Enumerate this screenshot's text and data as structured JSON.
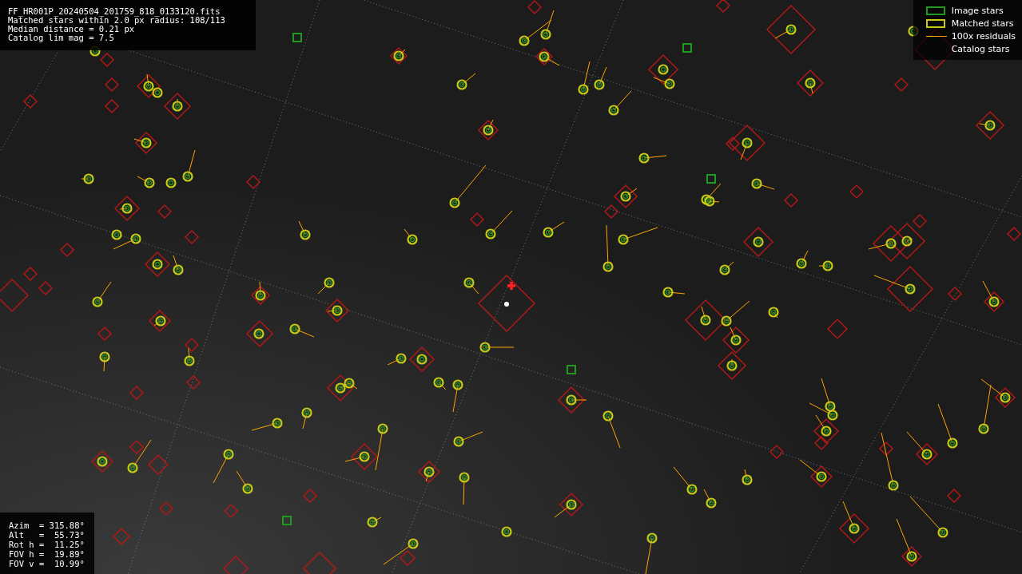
{
  "info": {
    "lines": [
      "FF_HR001P_20240504_201759_818_0133120.fits",
      "Matched stars within 2.0 px radius: 108/113",
      "Median distance = 0.21 px",
      "Catalog lim mag = 7.5"
    ]
  },
  "legend": [
    {
      "kind": "image",
      "label": "Image stars"
    },
    {
      "kind": "matched",
      "label": "Matched stars"
    },
    {
      "kind": "residual",
      "label": "100x residuals"
    },
    {
      "kind": "catalog",
      "label": "Catalog stars"
    }
  ],
  "pointing": {
    "lines": [
      "Azim  = 315.88°",
      "Alt   =  55.73°",
      "Rot h =  11.25°",
      "FOV h =  19.89°",
      "FOV v =  10.99°"
    ]
  }
}
